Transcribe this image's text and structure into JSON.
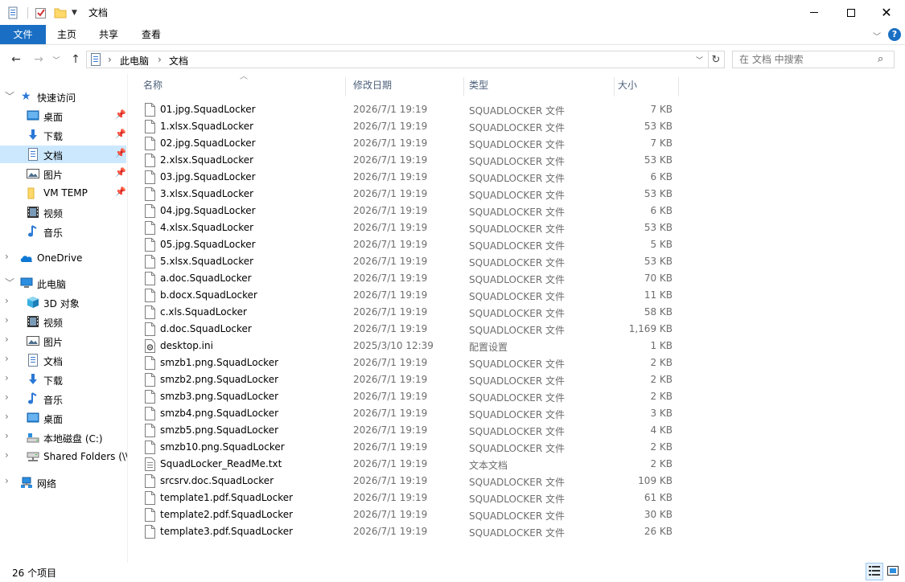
{
  "window": {
    "title": "文档",
    "controls": [
      "minimize-icon",
      "maximize-icon",
      "close-icon"
    ]
  },
  "ribbon": {
    "tabs": [
      {
        "label": "文件",
        "active": true
      },
      {
        "label": "主页"
      },
      {
        "label": "共享"
      },
      {
        "label": "查看"
      }
    ]
  },
  "address": {
    "crumbs": [
      "此电脑",
      "文档"
    ],
    "search_placeholder": "在 文档 中搜索"
  },
  "sidebar": {
    "quick_access": "快速访问",
    "quick_items": [
      {
        "label": "桌面",
        "icon": "desktop-icon",
        "pinned": true
      },
      {
        "label": "下载",
        "icon": "download-icon",
        "pinned": true
      },
      {
        "label": "文档",
        "icon": "document-icon",
        "pinned": true,
        "selected": true
      },
      {
        "label": "图片",
        "icon": "pictures-icon",
        "pinned": true
      },
      {
        "label": "VM TEMP",
        "icon": "folder-icon",
        "pinned": true
      },
      {
        "label": "视频",
        "icon": "video-icon"
      },
      {
        "label": "音乐",
        "icon": "music-icon"
      }
    ],
    "onedrive": "OneDrive",
    "this_pc": "此电脑",
    "pc_items": [
      {
        "label": "3D 对象",
        "icon": "3d-objects-icon"
      },
      {
        "label": "视频",
        "icon": "video-icon"
      },
      {
        "label": "图片",
        "icon": "pictures-icon"
      },
      {
        "label": "文档",
        "icon": "document-icon"
      },
      {
        "label": "下载",
        "icon": "download-icon"
      },
      {
        "label": "音乐",
        "icon": "music-icon"
      },
      {
        "label": "桌面",
        "icon": "desktop-icon"
      },
      {
        "label": "本地磁盘 (C:)",
        "icon": "drive-icon"
      },
      {
        "label": "Shared Folders (\\\\",
        "icon": "network-drive-icon"
      }
    ],
    "network": "网络"
  },
  "columns": {
    "name": "名称",
    "date": "修改日期",
    "type": "类型",
    "size": "大小"
  },
  "files": [
    {
      "name": "01.jpg.SquadLocker",
      "date": "2026/7/1 19:19",
      "type": "SQUADLOCKER 文件",
      "size": "7 KB"
    },
    {
      "name": "1.xlsx.SquadLocker",
      "date": "2026/7/1 19:19",
      "type": "SQUADLOCKER 文件",
      "size": "53 KB"
    },
    {
      "name": "02.jpg.SquadLocker",
      "date": "2026/7/1 19:19",
      "type": "SQUADLOCKER 文件",
      "size": "7 KB"
    },
    {
      "name": "2.xlsx.SquadLocker",
      "date": "2026/7/1 19:19",
      "type": "SQUADLOCKER 文件",
      "size": "53 KB"
    },
    {
      "name": "03.jpg.SquadLocker",
      "date": "2026/7/1 19:19",
      "type": "SQUADLOCKER 文件",
      "size": "6 KB"
    },
    {
      "name": "3.xlsx.SquadLocker",
      "date": "2026/7/1 19:19",
      "type": "SQUADLOCKER 文件",
      "size": "53 KB"
    },
    {
      "name": "04.jpg.SquadLocker",
      "date": "2026/7/1 19:19",
      "type": "SQUADLOCKER 文件",
      "size": "6 KB"
    },
    {
      "name": "4.xlsx.SquadLocker",
      "date": "2026/7/1 19:19",
      "type": "SQUADLOCKER 文件",
      "size": "53 KB"
    },
    {
      "name": "05.jpg.SquadLocker",
      "date": "2026/7/1 19:19",
      "type": "SQUADLOCKER 文件",
      "size": "5 KB"
    },
    {
      "name": "5.xlsx.SquadLocker",
      "date": "2026/7/1 19:19",
      "type": "SQUADLOCKER 文件",
      "size": "53 KB"
    },
    {
      "name": "a.doc.SquadLocker",
      "date": "2026/7/1 19:19",
      "type": "SQUADLOCKER 文件",
      "size": "70 KB"
    },
    {
      "name": "b.docx.SquadLocker",
      "date": "2026/7/1 19:19",
      "type": "SQUADLOCKER 文件",
      "size": "11 KB"
    },
    {
      "name": "c.xls.SquadLocker",
      "date": "2026/7/1 19:19",
      "type": "SQUADLOCKER 文件",
      "size": "58 KB"
    },
    {
      "name": "d.doc.SquadLocker",
      "date": "2026/7/1 19:19",
      "type": "SQUADLOCKER 文件",
      "size": "1,169 KB"
    },
    {
      "name": "desktop.ini",
      "date": "2025/3/10 12:39",
      "type": "配置设置",
      "size": "1 KB",
      "icon": "settings-file-icon"
    },
    {
      "name": "smzb1.png.SquadLocker",
      "date": "2026/7/1 19:19",
      "type": "SQUADLOCKER 文件",
      "size": "2 KB"
    },
    {
      "name": "smzb2.png.SquadLocker",
      "date": "2026/7/1 19:19",
      "type": "SQUADLOCKER 文件",
      "size": "2 KB"
    },
    {
      "name": "smzb3.png.SquadLocker",
      "date": "2026/7/1 19:19",
      "type": "SQUADLOCKER 文件",
      "size": "2 KB"
    },
    {
      "name": "smzb4.png.SquadLocker",
      "date": "2026/7/1 19:19",
      "type": "SQUADLOCKER 文件",
      "size": "3 KB"
    },
    {
      "name": "smzb5.png.SquadLocker",
      "date": "2026/7/1 19:19",
      "type": "SQUADLOCKER 文件",
      "size": "4 KB"
    },
    {
      "name": "smzb10.png.SquadLocker",
      "date": "2026/7/1 19:19",
      "type": "SQUADLOCKER 文件",
      "size": "2 KB"
    },
    {
      "name": "SquadLocker_ReadMe.txt",
      "date": "2026/7/1 19:19",
      "type": "文本文档",
      "size": "2 KB",
      "icon": "text-file-icon"
    },
    {
      "name": "srcsrv.doc.SquadLocker",
      "date": "2026/7/1 19:19",
      "type": "SQUADLOCKER 文件",
      "size": "109 KB"
    },
    {
      "name": "template1.pdf.SquadLocker",
      "date": "2026/7/1 19:19",
      "type": "SQUADLOCKER 文件",
      "size": "61 KB"
    },
    {
      "name": "template2.pdf.SquadLocker",
      "date": "2026/7/1 19:19",
      "type": "SQUADLOCKER 文件",
      "size": "30 KB"
    },
    {
      "name": "template3.pdf.SquadLocker",
      "date": "2026/7/1 19:19",
      "type": "SQUADLOCKER 文件",
      "size": "26 KB"
    }
  ],
  "status": {
    "count": "26 个项目"
  },
  "colors": {
    "accent": "#1a6fc4",
    "selection": "#cce8ff",
    "header_text": "#4c607a",
    "muted": "#6d6d6d"
  }
}
